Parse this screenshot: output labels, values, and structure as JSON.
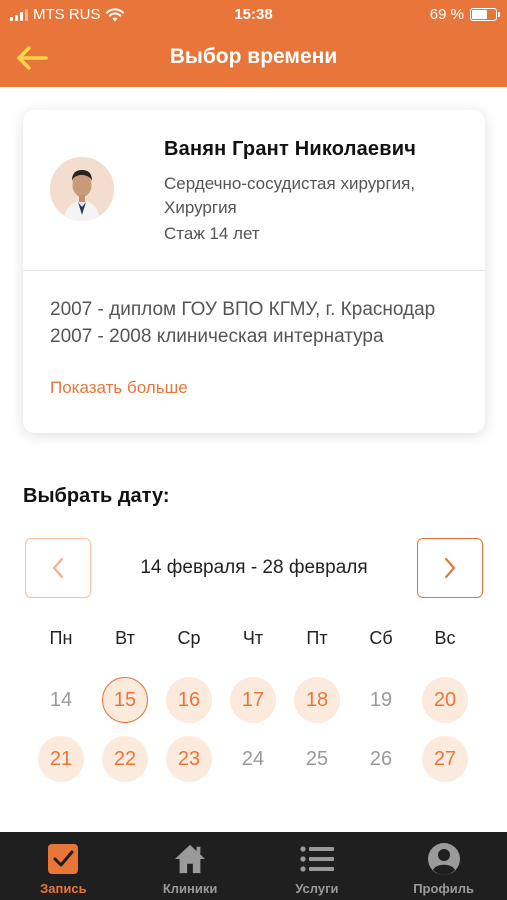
{
  "status_bar": {
    "carrier": "MTS RUS",
    "time": "15:38",
    "battery": "69 %",
    "battery_level": 0.69
  },
  "header": {
    "title": "Выбор времени",
    "back_icon": "arrow-left-icon"
  },
  "doctor": {
    "name": "Ванян Грант Николаевич",
    "specialty": "Сердечно-сосудистая хирургия, Хирургия",
    "experience": "Стаж 14 лет",
    "education": "2007 - диплом  ГОУ ВПО КГМУ, г. Краснодар\n2007 - 2008 клиническая интернатура",
    "show_more": "Показать больше"
  },
  "date_picker": {
    "heading": "Выбрать дату:",
    "range": "14 февраля - 28 февраля",
    "weekdays": [
      "Пн",
      "Вт",
      "Ср",
      "Чт",
      "Пт",
      "Сб",
      "Вс"
    ],
    "days": [
      {
        "label": "14",
        "state": "unavailable"
      },
      {
        "label": "15",
        "state": "selected"
      },
      {
        "label": "16",
        "state": "available"
      },
      {
        "label": "17",
        "state": "available"
      },
      {
        "label": "18",
        "state": "available"
      },
      {
        "label": "19",
        "state": "unavailable"
      },
      {
        "label": "20",
        "state": "available"
      },
      {
        "label": "21",
        "state": "available"
      },
      {
        "label": "22",
        "state": "available"
      },
      {
        "label": "23",
        "state": "available"
      },
      {
        "label": "24",
        "state": "unavailable"
      },
      {
        "label": "25",
        "state": "unavailable"
      },
      {
        "label": "26",
        "state": "unavailable"
      },
      {
        "label": "27",
        "state": "available"
      }
    ]
  },
  "tab_bar": {
    "tabs": [
      {
        "label": "Запись",
        "icon": "checkbox-icon",
        "active": true
      },
      {
        "label": "Клиники",
        "icon": "home-icon",
        "active": false
      },
      {
        "label": "Услуги",
        "icon": "list-icon",
        "active": false
      },
      {
        "label": "Профиль",
        "icon": "user-icon",
        "active": false
      }
    ]
  },
  "colors": {
    "accent": "#e8763b",
    "accent_light": "#fcebdd",
    "tab_bar_bg": "#1f1f1f"
  }
}
